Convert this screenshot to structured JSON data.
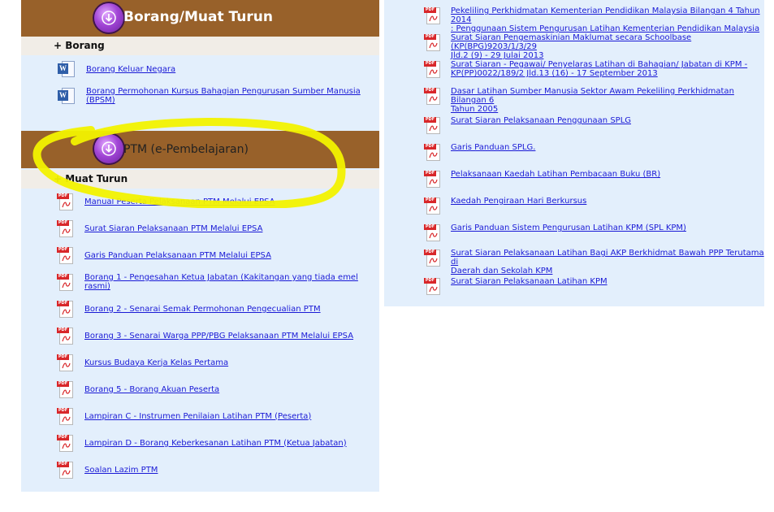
{
  "left": {
    "header_borang": {
      "title": "Borang/Muat Turun",
      "icon": "download-circle-icon"
    },
    "section_borang": {
      "label": "+ Borang",
      "items": [
        {
          "label": "Borang Keluar Negara",
          "icon": "word-doc-icon"
        },
        {
          "label": "Borang Permohonan Kursus Bahagian Pengurusan Sumber Manusia (BPSM)",
          "icon": "word-doc-icon"
        }
      ]
    },
    "header_ptm": {
      "title": "PTM (e-Pembelajaran)",
      "icon": "download-circle-icon"
    },
    "section_muat_turun": {
      "label": "+ Muat Turun",
      "items": [
        {
          "label": "Manual Peserta Pelaksanaan PTM Melalui EPSA",
          "icon": "pdf-icon"
        },
        {
          "label": "Surat Siaran Pelaksanaan PTM Melalui EPSA",
          "icon": "pdf-icon"
        },
        {
          "label": "Garis Panduan Pelaksanaan PTM Melalui EPSA",
          "icon": "pdf-icon"
        },
        {
          "label": "Borang 1 - Pengesahan Ketua Jabatan (Kakitangan yang tiada emel rasmi)",
          "icon": "pdf-icon"
        },
        {
          "label": "Borang 2 - Senarai Semak Permohonan Pengecualian PTM",
          "icon": "pdf-icon"
        },
        {
          "label": "Borang 3 - Senarai Warga PPP/PBG Pelaksanaan PTM Melalui EPSA",
          "icon": "pdf-icon"
        },
        {
          "label": "Kursus Budaya Kerja Kelas Pertama",
          "icon": "pdf-icon"
        },
        {
          "label": "Borang 5 - Borang Akuan Peserta",
          "icon": "pdf-icon"
        },
        {
          "label": "Lampiran C - Instrumen Penilaian Latihan PTM (Peserta)",
          "icon": "pdf-icon"
        },
        {
          "label": "Lampiran D - Borang Keberkesanan Latihan PTM (Ketua Jabatan)",
          "icon": "pdf-icon"
        },
        {
          "label": "Soalan Lazim PTM",
          "icon": "pdf-icon"
        }
      ]
    }
  },
  "right": {
    "items": [
      {
        "line1": "Pekeliling Perkhidmatan Kementerian Pendidikan Malaysia Bilangan 4 Tahun 2014",
        "line2": ": Penggunaan Sistem Pengurusan Latihan Kementerian Pendidikan Malaysia",
        "icon": "pdf-icon"
      },
      {
        "line1": "Surat Siaran Pengemaskinian Maklumat secara Schoolbase (KP(BPG)9203/1/3/29",
        "line2": "Jld.2 (9) - 29 Julai 2013",
        "icon": "pdf-icon"
      },
      {
        "line1": "Surat Siaran - Pegawai/ Penyelaras Latihan di Bahagian/ Jabatan di KPM -",
        "line2": "KP(PP)0022/189/2 Jld.13 (16) - 17 September 2013",
        "icon": "pdf-icon"
      },
      {
        "line1": "Dasar Latihan Sumber Manusia Sektor Awam Pekeliling Perkhidmatan Bilangan 6",
        "line2": "Tahun 2005",
        "icon": "pdf-icon"
      },
      {
        "line1": "Surat Siaran Pelaksanaan Penggunaan SPLG",
        "line2": "",
        "icon": "pdf-icon"
      },
      {
        "line1": "Garis Panduan SPLG.",
        "line2": "",
        "icon": "pdf-icon"
      },
      {
        "line1": "Pelaksanaan Kaedah Latihan Pembacaan Buku (BR)",
        "line2": "",
        "icon": "pdf-icon"
      },
      {
        "line1": "Kaedah Pengiraan Hari Berkursus",
        "line2": "",
        "icon": "pdf-icon"
      },
      {
        "line1": "Garis Panduan Sistem Pengurusan Latihan KPM (SPL KPM)",
        "line2": "",
        "icon": "pdf-icon"
      },
      {
        "line1": "Surat Siaran Pelaksanaan Latihan Bagi AKP Berkhidmat Bawah PPP Terutama di",
        "line2": "Daerah dan Sekolah KPM",
        "icon": "pdf-icon"
      },
      {
        "line1": "Surat Siaran Pelaksanaan Latihan KPM",
        "line2": "",
        "icon": "pdf-icon"
      }
    ]
  },
  "colors": {
    "header_band": "#98612a",
    "panel_bg": "#e3effc",
    "subheader_bg": "#f1ede7",
    "link": "#1a1ad6",
    "highlight_marker": "#f2f200"
  }
}
